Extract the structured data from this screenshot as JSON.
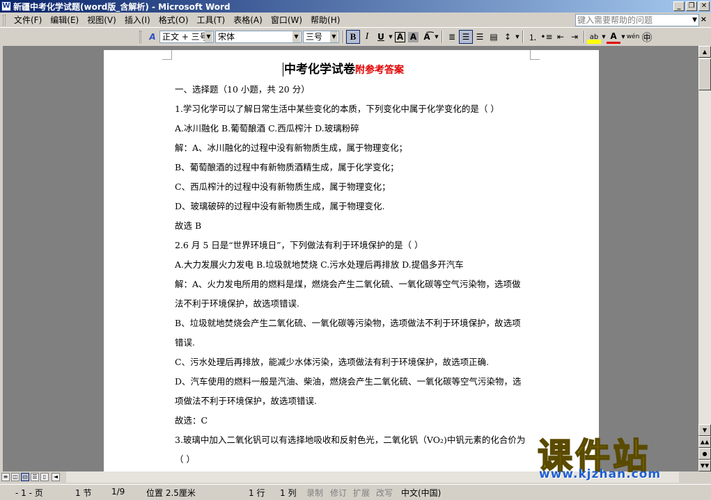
{
  "window": {
    "title": "新疆中考化学试题(word版_含解析) - Microsoft Word"
  },
  "menu": {
    "items": [
      "文件(F)",
      "编辑(E)",
      "视图(V)",
      "插入(I)",
      "格式(O)",
      "工具(T)",
      "表格(A)",
      "窗口(W)",
      "帮助(H)"
    ],
    "help_placeholder": "键入需要帮助的问题"
  },
  "toolbar": {
    "style": "正文 + 三号",
    "font": "宋体",
    "size": "三号",
    "bold": "B",
    "italic": "I",
    "underline": "U",
    "char_border": "A",
    "char_shading": "A",
    "font_color": "A",
    "wen": "wén"
  },
  "document": {
    "title_main": "中考化学试卷",
    "title_suffix": "附参考答案",
    "lines": [
      "一、选择题（10 小题，共 20 分）",
      "1.学习化学可以了解日常生活中某些变化的本质，下列变化中属于化学变化的是（      ）",
      "A.冰川融化      B.葡萄酿酒      C.西瓜榨汁      D.玻璃粉碎",
      "解：A、冰川融化的过程中没有新物质生成，属于物理变化；",
      "B、葡萄酿酒的过程中有新物质酒精生成，属于化学变化；",
      "C、西瓜榨汁的过程中没有新物质生成，属于物理变化；",
      "D、玻璃破碎的过程中没有新物质生成，属于物理变化.",
      "故选 B",
      "2.6 月 5 日是“世界环境日”，下列做法有利于环境保护的是（      ）",
      "A.大力发展火力发电      B.垃圾就地焚烧      C.污水处理后再排放      D.提倡多开汽车",
      "解：A、火力发电所用的燃料是煤，燃烧会产生二氧化硫、一氧化碳等空气污染物，选项做",
      "法不利于环境保护，故选项错误.",
      "B、垃圾就地焚烧会产生二氧化硫、一氧化碳等污染物，选项做法不利于环境保护，故选项",
      "错误.",
      "C、污水处理后再排放，能减少水体污染，选项做法有利于环境保护，故选项正确.",
      "D、汽车使用的燃料一般是汽油、柴油，燃烧会产生二氧化硫、一氧化碳等空气污染物，选",
      "项做法不利于环境保护，故选项错误.",
      "故选：C",
      "3.玻璃中加入二氧化钒可以有选择地吸收和反射色光，二氧化钒（VO₂)中钒元素的化合价为",
      "（      ）"
    ]
  },
  "status": {
    "page": "- 1 - 页",
    "section": "1 节",
    "pages": "1/9",
    "position": "位置 2.5厘米",
    "line": "1 行",
    "col": "1 列",
    "rec": "录制",
    "trk": "修订",
    "ext": "扩展",
    "ovr": "改写",
    "lang": "中文(中国)"
  },
  "watermark": {
    "text": "课件站",
    "url": "www.kjzhan.com"
  }
}
